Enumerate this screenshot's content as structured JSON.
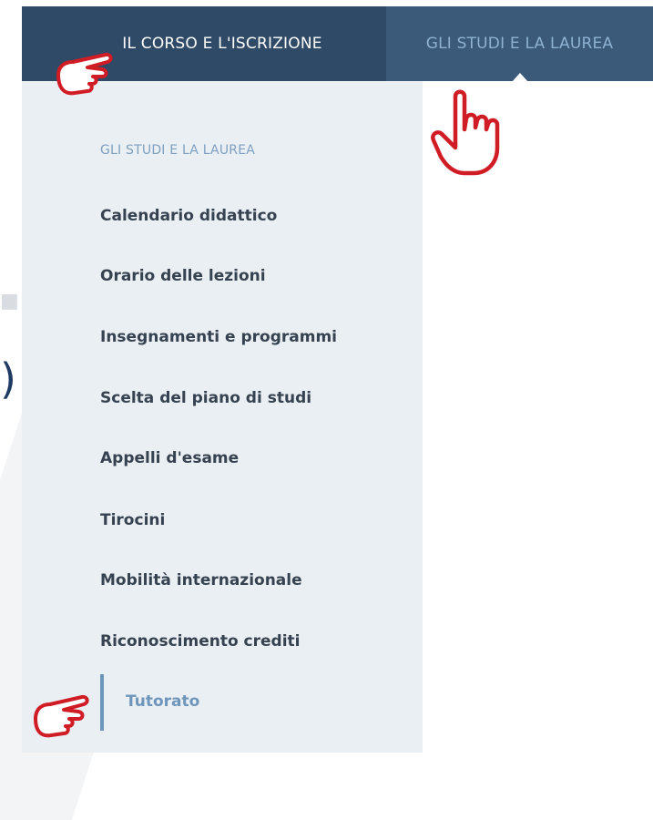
{
  "nav": {
    "tabs": [
      {
        "label": "IL CORSO E L'ISCRIZIONE"
      },
      {
        "label": "GLI STUDI E LA LAUREA"
      }
    ]
  },
  "panel": {
    "title": "GLI STUDI E LA LAUREA",
    "items": [
      {
        "label": "Calendario didattico"
      },
      {
        "label": "Orario delle lezioni"
      },
      {
        "label": "Insegnamenti e programmi"
      },
      {
        "label": "Scelta del piano di studi"
      },
      {
        "label": "Appelli d'esame"
      },
      {
        "label": "Tirocini"
      },
      {
        "label": "Mobilità internazionale"
      },
      {
        "label": "Riconoscimento crediti"
      },
      {
        "label": "Tutorato"
      }
    ]
  },
  "background": {
    "paren": ")"
  },
  "colors": {
    "nav_bg": "#2f4a67",
    "nav_active_bg": "#3b5979",
    "panel_bg": "#eaeff4",
    "accent": "#6f95ba",
    "hand_outline": "#d01c24"
  },
  "icons": {
    "annotations": [
      "hand-pointing-right-icon",
      "hand-pointing-up-icon",
      "hand-pointing-right-icon"
    ]
  }
}
